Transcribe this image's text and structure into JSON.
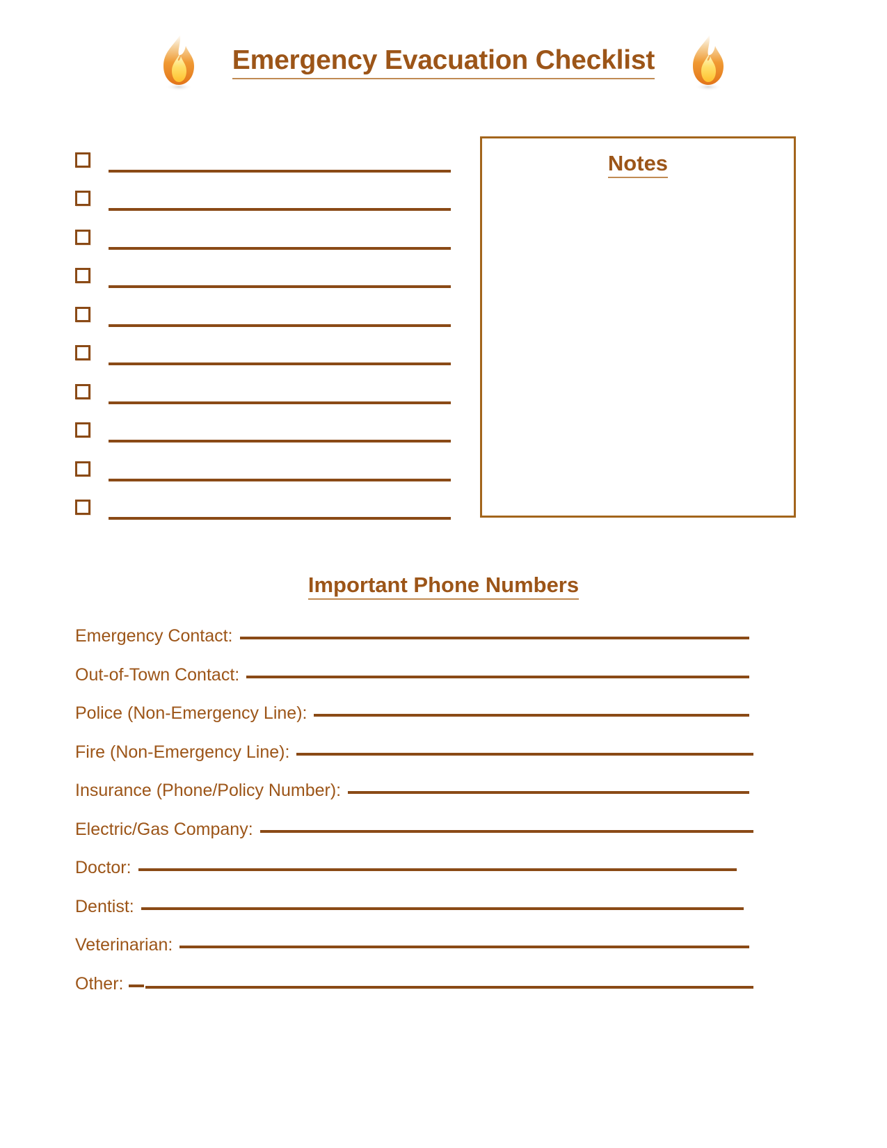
{
  "document": {
    "title": "Emergency Evacuation Checklist",
    "left_icon": "flame-icon",
    "right_icon": "flame-icon"
  },
  "checklist": {
    "item_count": 10,
    "items": [
      {
        "checked": false,
        "text": ""
      },
      {
        "checked": false,
        "text": ""
      },
      {
        "checked": false,
        "text": ""
      },
      {
        "checked": false,
        "text": ""
      },
      {
        "checked": false,
        "text": ""
      },
      {
        "checked": false,
        "text": ""
      },
      {
        "checked": false,
        "text": ""
      },
      {
        "checked": false,
        "text": ""
      },
      {
        "checked": false,
        "text": ""
      },
      {
        "checked": false,
        "text": ""
      }
    ]
  },
  "notes": {
    "heading": "Notes",
    "content": ""
  },
  "phone_section": {
    "heading": "Important Phone Numbers",
    "rows": [
      {
        "label": "Emergency Contact:",
        "value": ""
      },
      {
        "label": "Out-of-Town Contact:",
        "value": ""
      },
      {
        "label": "Police (Non-Emergency Line):",
        "value": ""
      },
      {
        "label": "Fire (Non-Emergency Line):",
        "value": ""
      },
      {
        "label": "Insurance (Phone/Policy Number):",
        "value": ""
      },
      {
        "label": "Electric/Gas Company:",
        "value": ""
      },
      {
        "label": "Doctor:",
        "value": ""
      },
      {
        "label": "Dentist:",
        "value": ""
      },
      {
        "label": "Veterinarian:",
        "value": ""
      },
      {
        "label": "Other:",
        "value": ""
      }
    ]
  },
  "colors": {
    "text_brown": "#9C5518",
    "rule_brown": "#8a4a16",
    "border_brown": "#a3651c",
    "underline_brown": "#c08a52",
    "page_background": "#ffffff"
  }
}
